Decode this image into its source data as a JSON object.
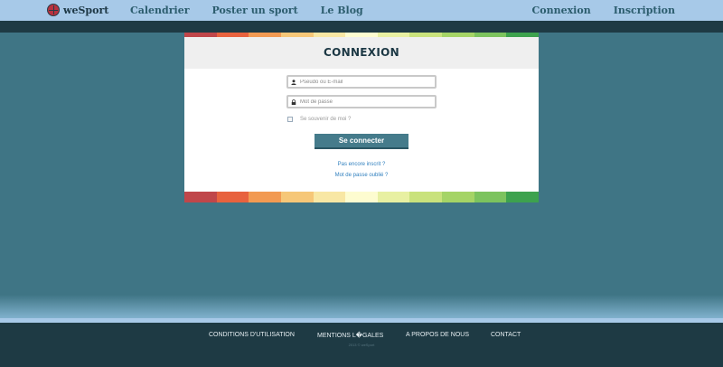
{
  "nav": {
    "brand": "weSport",
    "left_links": [
      "Calendrier",
      "Poster un sport",
      "Le Blog"
    ],
    "right_links": [
      "Connexion",
      "Inscription"
    ]
  },
  "login": {
    "title": "CONNEXION",
    "username_placeholder": "Pseudo ou E-mail",
    "password_placeholder": "Mot de passe",
    "remember_label": "Se souvenir de moi ?",
    "submit_label": "Se connecter",
    "signup_link": "Pas encore inscrit ?",
    "forgot_link": "Mot de passe oublié ?"
  },
  "footer": {
    "links": [
      "CONDITIONS D'UTILISATION",
      "MENTIONS L�GALES",
      "A PROPOS DE NOUS",
      "CONTACT"
    ],
    "copyright": "2013 © weSport"
  },
  "colors": {
    "nav_bg": "#a7c9e8",
    "page_bg": "#3f7585",
    "dark_bg": "#1e3a44",
    "button_bg": "#457b8b",
    "link": "#2f7fbe",
    "stripe": [
      "#c0464a",
      "#e8623e",
      "#f29a52",
      "#f6c778",
      "#f8e7a4",
      "#fdfcd0",
      "#e8f0a2",
      "#c9e27c",
      "#a5d466",
      "#7cc35e",
      "#3da24e"
    ]
  }
}
